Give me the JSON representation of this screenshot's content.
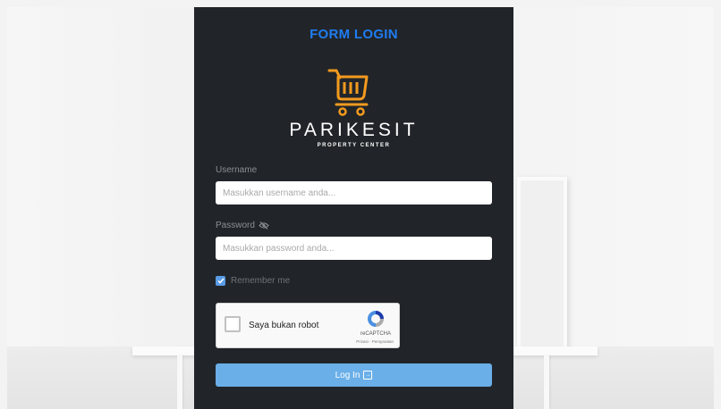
{
  "form": {
    "title": "FORM LOGIN",
    "brand_name": "PARIKESIT",
    "brand_tagline": "PROPERTY CENTER",
    "logo_icon": "shopping-cart-icon",
    "username_label": "Username",
    "username_placeholder": "Masukkan username anda...",
    "password_label": "Password",
    "password_toggle_icon": "eye-slash-icon",
    "password_placeholder": "Masukkan password anda...",
    "remember_label": "Remember me",
    "remember_checked": true,
    "captcha_label": "Saya bukan robot",
    "captcha_brand": "reCAPTCHA",
    "captcha_terms": "Privasi - Persyaratan",
    "login_label": "Log In",
    "login_icon": "sign-in-icon"
  },
  "colors": {
    "panel_bg": "#212529",
    "title": "#1f7cf0",
    "logo_orange": "#f39a1e",
    "button_bg": "#6aafe8",
    "checkbox": "#5a9be6"
  }
}
